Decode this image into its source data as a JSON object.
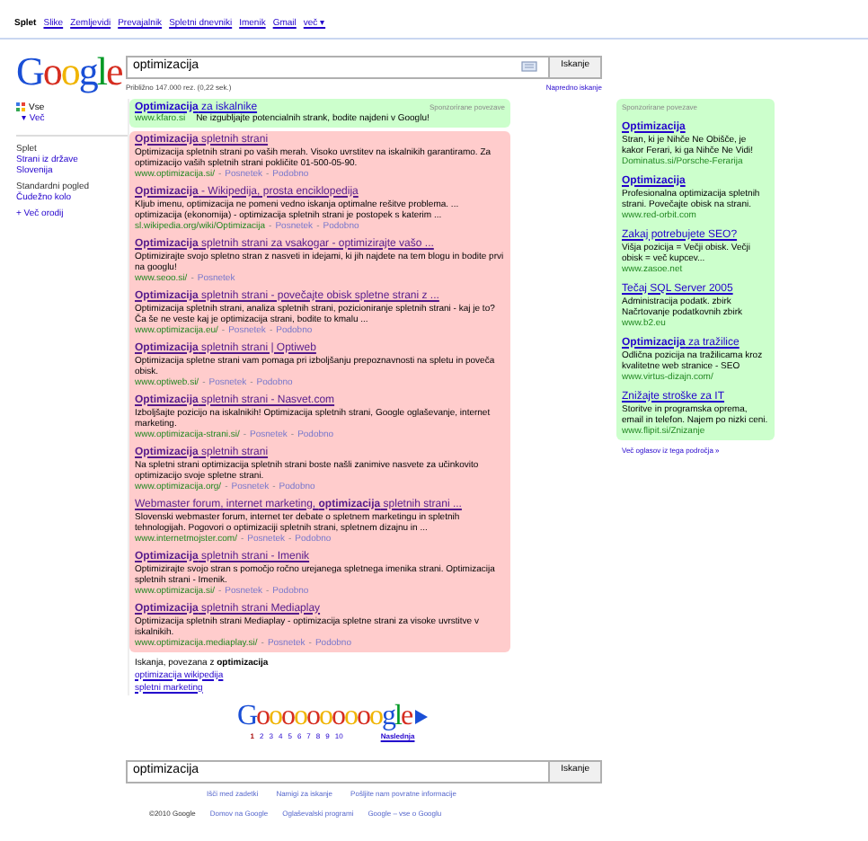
{
  "topnav": {
    "items": [
      {
        "label": "Splet",
        "selected": true
      },
      {
        "label": "Slike",
        "selected": false
      },
      {
        "label": "Zemljevidi",
        "selected": false
      },
      {
        "label": "Prevajalnik",
        "selected": false
      },
      {
        "label": "Spletni dnevniki",
        "selected": false
      },
      {
        "label": "Imenik",
        "selected": false
      },
      {
        "label": "Gmail",
        "selected": false
      },
      {
        "label": "več ▾",
        "selected": false
      }
    ]
  },
  "logo": "Google",
  "search": {
    "value": "optimizacija",
    "button": "Iskanje"
  },
  "stats": "Približno 147.000 rez. (0,22 sek.)",
  "advanced": "Napredno iskanje",
  "sidebar": {
    "mode": "Vse",
    "more": "▾ Več",
    "sections": [
      {
        "heading": "Splet",
        "links": [
          "Strani iz države Slovenija"
        ]
      },
      {
        "heading": "Standardni pogled",
        "links": [
          "Čudežno kolo"
        ]
      }
    ],
    "tools": "+ Več orodij"
  },
  "top_ad": {
    "label": "Sponzorirane povezave",
    "title": "**Optimizacija** za iskalnike",
    "url": "www.kfaro.si",
    "text": "Ne izgubljajte potencialnih strank, bodite najdeni v Googlu!"
  },
  "results": [
    {
      "title": "**Optimizacija** spletnih strani",
      "snippet": "Optimizacija spletnih strani po vaših merah. Visoko uvrstitev na iskalnikih garantiramo. Za optimizacijo vaših spletnih strani pokličite 01-500-05-90.",
      "url": "www.optimizacija.si/",
      "separators": [
        "-",
        "-"
      ],
      "links": [
        "Posnetek",
        "Podobno"
      ]
    },
    {
      "title": "**Optimizacija** - Wikipedija, prosta enciklopedija",
      "snippet": "Kljub imenu, optimizacija ne pomeni vedno iskanja optimalne rešitve problema. ... optimizacija (ekonomija) - optimizacija spletnih strani je postopek s katerim ...",
      "url": "sl.wikipedia.org/wiki/Optimizacija",
      "separators": [
        "-",
        "-"
      ],
      "links": [
        "Posnetek",
        "Podobno"
      ]
    },
    {
      "title": "**Optimizacija** spletnih strani za vsakogar - optimizirajte vašo ...",
      "snippet": "Optimizirajte svojo spletno stran z nasveti in idejami, ki jih najdete na tem blogu in bodite prvi na googlu!",
      "url": "www.seoo.si/",
      "separators": [
        "-"
      ],
      "links": [
        "Posnetek"
      ]
    },
    {
      "title": "**Optimizacija** spletnih strani - povečajte obisk spletne strani z ...",
      "snippet": "Optimizacija spletnih strani, analiza spletnih strani, pozicioniranje spletnih strani - kaj je to? Ča še ne veste kaj je optimizacija strani, bodite to kmalu ...",
      "url": "www.optimizacija.eu/",
      "separators": [
        "-",
        "-"
      ],
      "links": [
        "Posnetek",
        "Podobno"
      ]
    },
    {
      "title": "**Optimizacija** spletnih strani | Optiweb",
      "snippet": "Optimizacija spletne strani vam pomaga pri izboljšanju prepoznavnosti na spletu in poveča obisk.",
      "url": "www.optiweb.si/",
      "separators": [
        "-",
        "-"
      ],
      "links": [
        "Posnetek",
        "Podobno"
      ]
    },
    {
      "title": "**Optimizacija** spletnih strani - Nasvet.com",
      "snippet": "Izboljšajte pozicijo na iskalnikih! Optimizacija spletnih strani, Google oglaševanje, internet marketing.",
      "url": "www.optimizacija-strani.si/",
      "separators": [
        "-",
        "-"
      ],
      "links": [
        "Posnetek",
        "Podobno"
      ]
    },
    {
      "title": "**Optimizacija** spletnih strani",
      "snippet": "Na spletni strani optimizacija spletnih strani boste našli zanimive nasvete za učinkovito optimizacijo svoje spletne strani.",
      "url": "www.optimizacija.org/",
      "separators": [
        "-",
        "-"
      ],
      "links": [
        "Posnetek",
        "Podobno"
      ]
    },
    {
      "title": "Webmaster forum, internet marketing, **optimizacija** spletnih strani ...",
      "snippet": "Slovenski webmaster forum, internet ter debate o spletnem marketingu in spletnih tehnologijah. Pogovori o optimizaciji spletnih strani, spletnem dizajnu in ...",
      "url": "www.internetmojster.com/",
      "separators": [
        "-",
        "-"
      ],
      "links": [
        "Posnetek",
        "Podobno"
      ]
    },
    {
      "title": "**Optimizacija** spletnih strani - Imenik",
      "snippet": "Optimizirajte svojo stran s pomočjo ročno urejanega spletnega imenika strani. Optimizacija spletnih strani - Imenik.",
      "url": "www.optimizacija.si/",
      "separators": [
        "-",
        "-"
      ],
      "links": [
        "Posnetek",
        "Podobno"
      ]
    },
    {
      "title": "**Optimizacija** spletnih strani Mediaplay",
      "snippet": "Optimizacija spletnih strani Mediaplay - optimizacija spletne strani za visoke uvrstitve v iskalnikih.",
      "url": "www.optimizacija.mediaplay.si/",
      "separators": [
        "-",
        "-"
      ],
      "links": [
        "Posnetek",
        "Podobno"
      ]
    }
  ],
  "related": {
    "heading": "Iskanja, povezana z **optimizacija**",
    "links": [
      "optimizacija wikipedija",
      "spletni marketing"
    ]
  },
  "side_ads": {
    "label": "Sponzorirane povezave",
    "ads": [
      {
        "title": "**Optimizacija**",
        "text": "Stran, ki je Nihče Ne Obišče, je kakor Ferari, ki ga Nihče Ne Vidi!",
        "url": "Dominatus.si/Porsche-Ferarija"
      },
      {
        "title": "**Optimizacija**",
        "text": "Profesionalna optimizacija spletnih strani. Povečajte obisk na strani.",
        "url": "www.red-orbit.com"
      },
      {
        "title": "Zakaj potrebujete SEO?",
        "text": "Višja pozicija = Večji obisk. Večji obisk = več kupcev...",
        "url": "www.zasoe.net"
      },
      {
        "title": "Tečaj SQL Server 2005",
        "text": "Administracija podatk. zbirk Načrtovanje podatkovnih zbirk",
        "url": "www.b2.eu"
      },
      {
        "title": "**Optimizacija** za tražilice",
        "text": "Odlična pozicija na tražilicama kroz kvalitetne web stranice - SEO",
        "url": "www.virtus-dizajn.com/"
      },
      {
        "title": "Znižajte stroške za IT",
        "text": "Storitve in programska oprema, email in telefon. Najem po nizki ceni.",
        "url": "www.flipit.si/Znizanje"
      }
    ],
    "more": "Več oglasov iz tega področja »"
  },
  "pagination": {
    "logo": "Goooooooooogle",
    "pages": [
      {
        "label": "1",
        "selected": true
      },
      {
        "label": "2",
        "selected": false
      },
      {
        "label": "3",
        "selected": false
      },
      {
        "label": "4",
        "selected": false
      },
      {
        "label": "5",
        "selected": false
      },
      {
        "label": "6",
        "selected": false
      },
      {
        "label": "7",
        "selected": false
      },
      {
        "label": "8",
        "selected": false
      },
      {
        "label": "9",
        "selected": false
      },
      {
        "label": "10",
        "selected": false
      }
    ],
    "next": "Naslednja"
  },
  "bottom_search": {
    "value": "optimizacija",
    "button": "Iskanje"
  },
  "bottom_links": [
    "Išči med zadetki",
    "Namigi za iskanje",
    "Pošljite nam povratne informacije"
  ],
  "footer": {
    "copyright": "©2010 Google",
    "links": [
      "Domov na Google",
      "Oglaševalski programi",
      "Google – vse o Googlu"
    ]
  }
}
